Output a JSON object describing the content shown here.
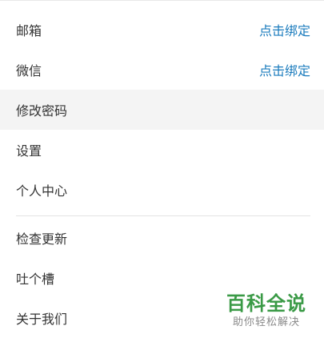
{
  "menu": {
    "items": [
      {
        "label": "邮箱",
        "action": "点击绑定"
      },
      {
        "label": "微信",
        "action": "点击绑定"
      },
      {
        "label": "修改密码"
      },
      {
        "label": "设置"
      },
      {
        "label": "个人中心"
      }
    ],
    "items_after_divider": [
      {
        "label": "检查更新"
      },
      {
        "label": "吐个槽"
      },
      {
        "label": "关于我们"
      }
    ]
  },
  "watermark": {
    "title": "百科全说",
    "subtitle": "助你轻松解决"
  },
  "colors": {
    "action_link": "#1a7bbd",
    "hover_row": "#f4f4f4",
    "watermark_green": "#3a9a46"
  }
}
